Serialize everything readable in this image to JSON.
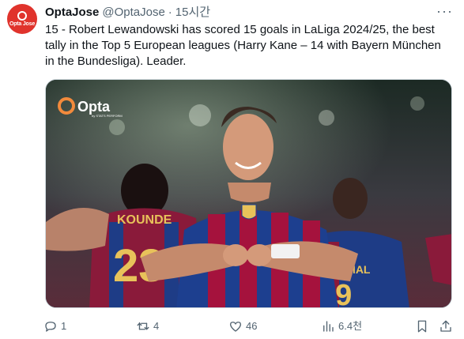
{
  "tweet": {
    "author_name": "OptaJose",
    "author_handle": "@OptaJose",
    "separator": "·",
    "time": "15시간",
    "avatar_text": "Opta Jose",
    "text": "15 - Robert Lewandowski has scored 15 goals in LaLiga 2024/25, the best tally in the Top 5 European leagues (Harry Kane – 14 with Bayern München in the Bundesliga). Leader."
  },
  "media": {
    "logo_text": "Opta",
    "logo_sub": "by STATS PERFORM",
    "back_name": "KOUNDE",
    "back_number": "23",
    "right_name": "YAMAL",
    "right_number": "19"
  },
  "actions": {
    "reply": {
      "icon": "reply-icon",
      "count": "1"
    },
    "retweet": {
      "icon": "retweet-icon",
      "count": "4"
    },
    "like": {
      "icon": "heart-icon",
      "count": "46"
    },
    "views": {
      "icon": "views-icon",
      "count": "6.4천"
    },
    "bookmark": {
      "icon": "bookmark-icon"
    },
    "share": {
      "icon": "share-icon"
    }
  },
  "colors": {
    "brand": "#e0332c",
    "text": "#0f1419",
    "muted": "#536471",
    "barca_blue": "#1d3f8f",
    "barca_red": "#a5123d"
  }
}
